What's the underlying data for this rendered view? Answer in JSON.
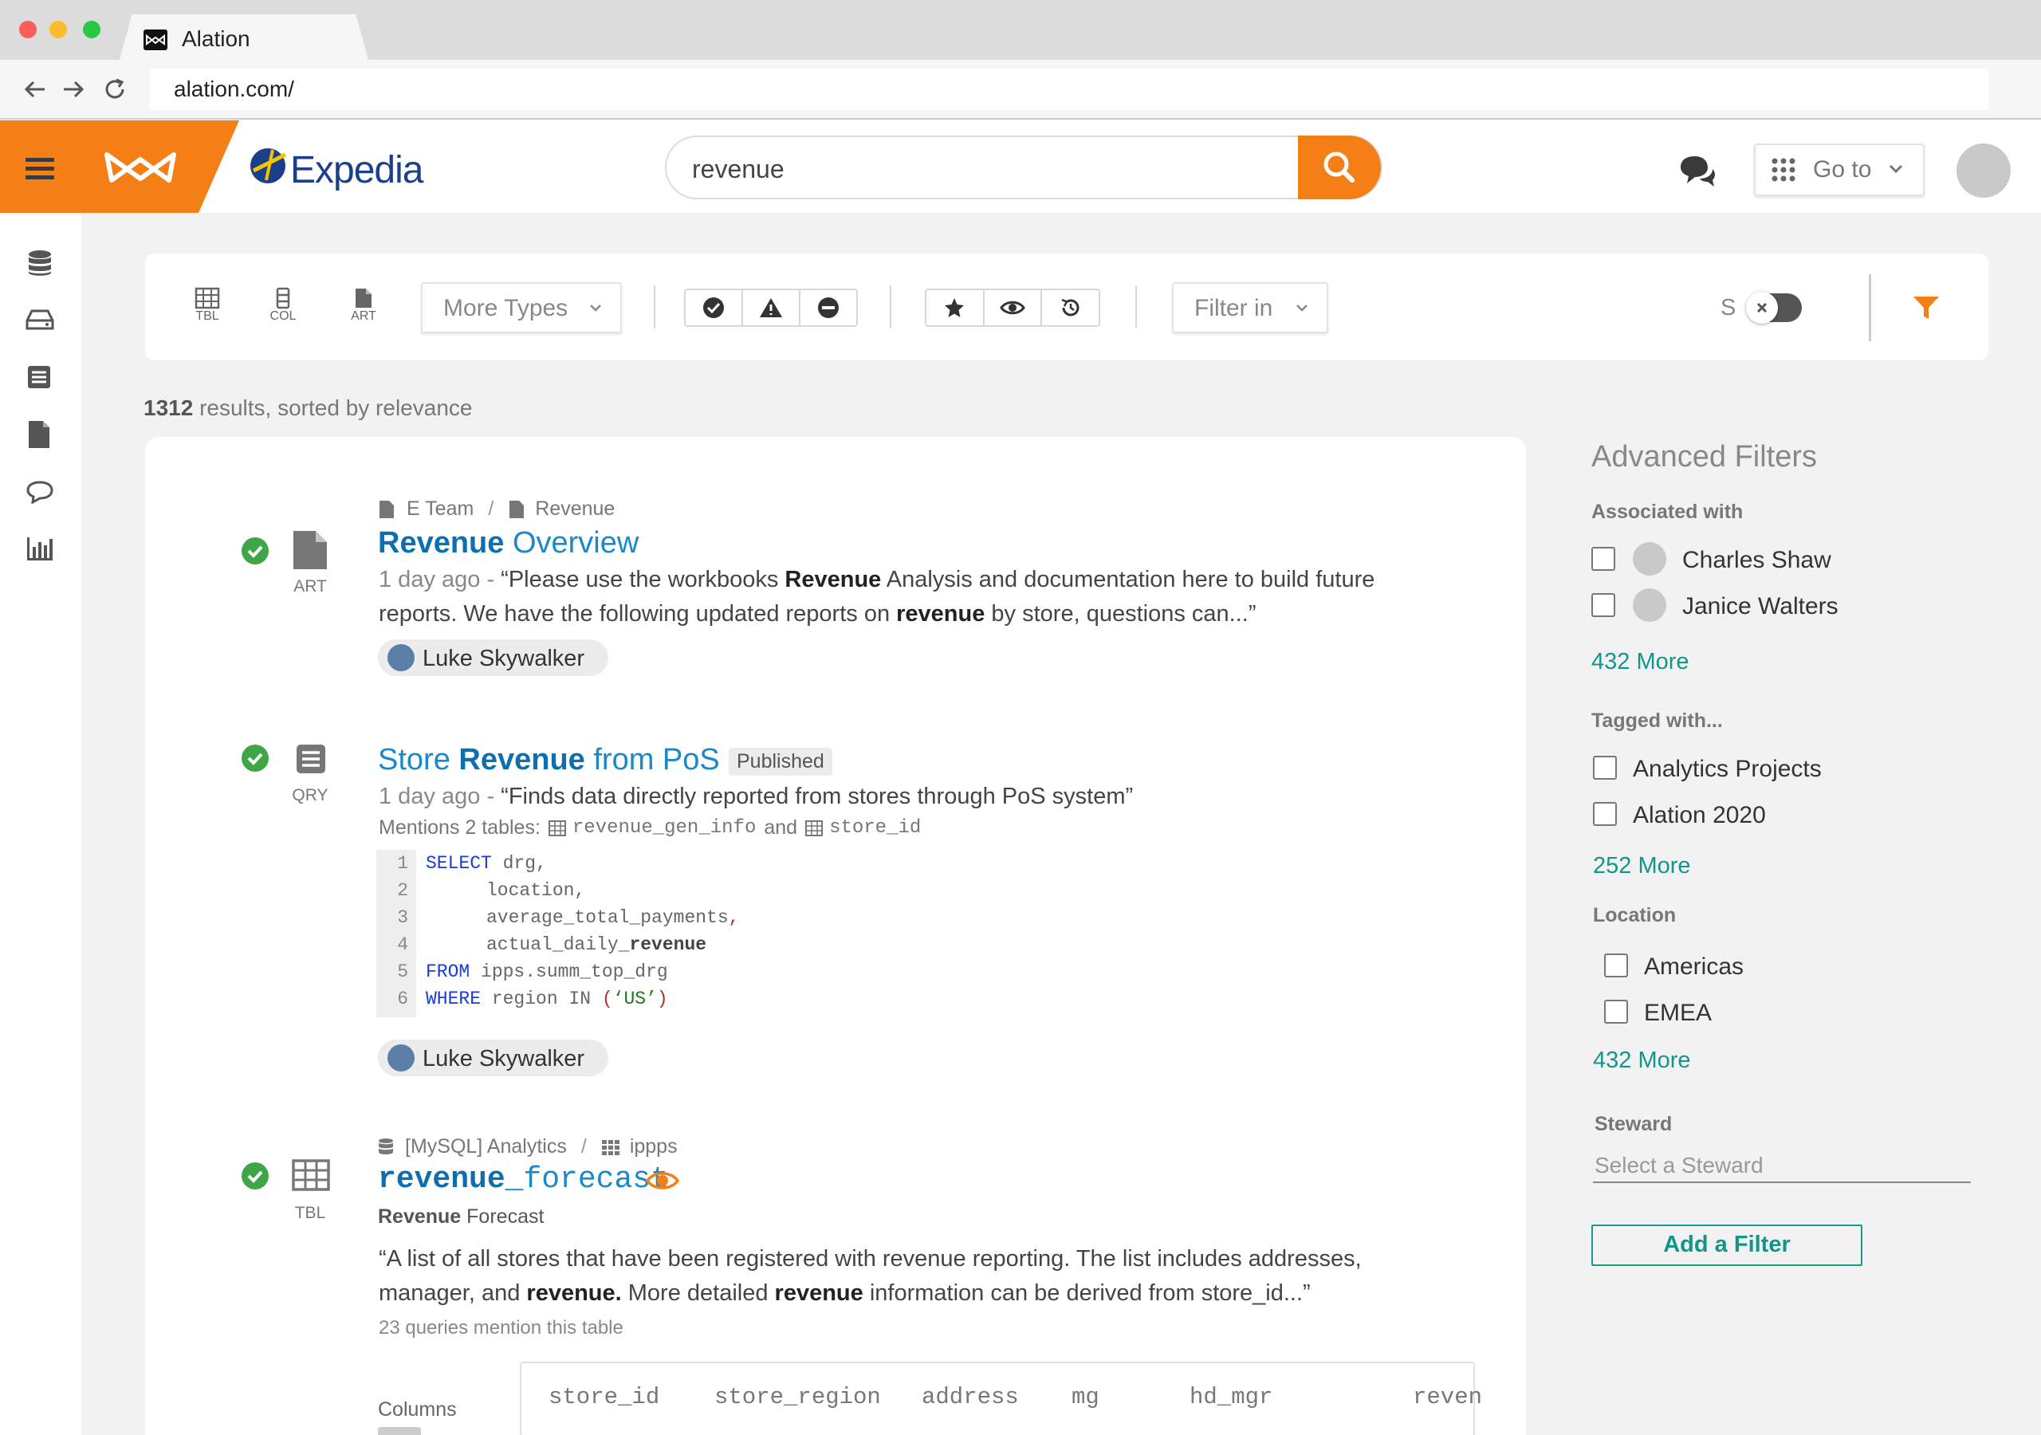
{
  "browser": {
    "tab_title": "Alation",
    "address": "alation.com/"
  },
  "header": {
    "company_name": "Expedia",
    "search_value": "revenue",
    "goto_label": "Go to"
  },
  "filter_bar": {
    "types": [
      "TBL",
      "COL",
      "ART"
    ],
    "more_types_label": "More Types",
    "filter_in_label": "Filter in",
    "toggle_label": "S"
  },
  "results_summary": {
    "count": "1312",
    "suffix": "results, sorted by relevance"
  },
  "results": [
    {
      "type": "ART",
      "breadcrumb": [
        "E Team",
        "Revenue"
      ],
      "title_bold": "Revenue",
      "title_rest": " Overview",
      "date": "1 day ago - ",
      "desc": [
        {
          "t": "“Please use the workbooks ",
          "b": false
        },
        {
          "t": "Revenue",
          "b": true
        },
        {
          "t": " Analysis and documentation here to build future",
          "b": false
        }
      ],
      "desc2": [
        {
          "t": "reports. We have the following updated reports on ",
          "b": false
        },
        {
          "t": "revenue",
          "b": true
        },
        {
          "t": " by store, questions can...”",
          "b": false
        }
      ],
      "user": "Luke Skywalker"
    },
    {
      "type": "QRY",
      "title_pre": "Store ",
      "title_bold": "Revenue",
      "title_rest": " from PoS",
      "badge": "Published",
      "date": "1 day ago - ",
      "desc": "“Finds data directly reported from stores through PoS system”",
      "mentions_label": "Mentions 2 tables:",
      "mention_table_1": "revenue_gen_info",
      "mention_and": "and",
      "mention_table_2": "store_id",
      "code_lines": [
        "1",
        "2",
        "3",
        "4",
        "5",
        "6"
      ],
      "user": "Luke Skywalker"
    },
    {
      "type": "TBL",
      "breadcrumb": [
        "[MySQL] Analytics",
        "ippps"
      ],
      "title_bold": "revenue",
      "title_rest": "_forecast",
      "subtitle_bold": "Revenue",
      "subtitle_rest": " Forecast",
      "desc1": "“A list of all stores that have been registered with revenue reporting. The list includes addresses,",
      "desc2_a": "manager, and ",
      "desc2_b": "revenue.",
      "desc2_c": " More detailed ",
      "desc2_d": "revenue",
      "desc2_e": " information can be derived from store_id...”",
      "mention_count": "23 queries mention this table",
      "columns_label": "Columns",
      "columns": [
        "store_id",
        "store_region",
        "address",
        "mg",
        "hd_mgr",
        "reven"
      ]
    }
  ],
  "code": {
    "l1_kw": "SELECT",
    "l1_id": " drg",
    "l1_p": ",",
    "l2_id": "location",
    "l2_p": ",",
    "l3_id": "average_total_payments",
    "l3_p": ",",
    "l4_id": "actual_daily_",
    "l4_b": "revenue",
    "l5_kw": "FROM",
    "l5_id": " ipps.summ_top_drg",
    "l6_kw": "WHERE",
    "l6_id": " region IN ",
    "l6_p1": "(",
    "l6_str": "‘US’",
    "l6_p2": ")"
  },
  "advanced_filters": {
    "title": "Advanced Filters",
    "associated_heading": "Associated with",
    "associated": [
      "Charles Shaw",
      "Janice Walters"
    ],
    "associated_more": "432 More",
    "tagged_heading": "Tagged with...",
    "tagged": [
      "Analytics Projects",
      "Alation 2020"
    ],
    "tagged_more": "252 More",
    "location_heading": "Location",
    "locations": [
      "Americas",
      "EMEA"
    ],
    "location_more": "432 More",
    "steward_heading": "Steward",
    "steward_placeholder": "Select a Steward",
    "add_filter_label": "Add a Filter"
  },
  "colors": {
    "brand_orange": "#f57f17",
    "link_blue": "#1a88c9",
    "teal": "#13968a",
    "success_green": "#3ea645"
  },
  "icons": {
    "sidebar": [
      "database-icon",
      "drive-icon",
      "table-list-icon",
      "document-icon",
      "chat-bubble-icon",
      "bar-chart-icon"
    ]
  }
}
